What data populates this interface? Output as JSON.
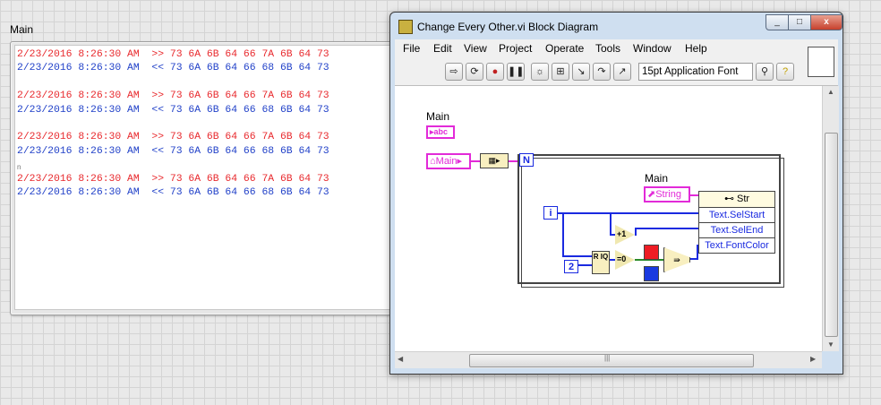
{
  "front_panel": {
    "label": "Main",
    "lines": [
      {
        "ts": "2/23/2016 8:26:30 AM",
        "dir": ">>",
        "bytes": "73 6A 6B 64 66 7A 6B 64 73",
        "color": "red"
      },
      {
        "ts": "2/23/2016 8:26:30 AM",
        "dir": "<<",
        "bytes": "73 6A 6B 64 66 68 6B 64 73",
        "color": "blue"
      },
      {
        "ts": "2/23/2016 8:26:30 AM",
        "dir": ">>",
        "bytes": "73 6A 6B 64 66 7A 6B 64 73",
        "color": "red"
      },
      {
        "ts": "2/23/2016 8:26:30 AM",
        "dir": "<<",
        "bytes": "73 6A 6B 64 66 68 6B 64 73",
        "color": "blue"
      },
      {
        "ts": "2/23/2016 8:26:30 AM",
        "dir": ">>",
        "bytes": "73 6A 6B 64 66 7A 6B 64 73",
        "color": "red"
      },
      {
        "ts": "2/23/2016 8:26:30 AM",
        "dir": "<<",
        "bytes": "73 6A 6B 64 66 68 6B 64 73",
        "color": "blue"
      },
      {
        "ts": "2/23/2016 8:26:30 AM",
        "dir": ">>",
        "bytes": "73 6A 6B 64 66 7A 6B 64 73",
        "color": "red"
      },
      {
        "ts": "2/23/2016 8:26:30 AM",
        "dir": "<<",
        "bytes": "73 6A 6B 64 66 68 6B 64 73",
        "color": "blue"
      }
    ]
  },
  "window": {
    "title": "Change Every Other.vi Block Diagram",
    "menu": [
      "File",
      "Edit",
      "View",
      "Project",
      "Operate",
      "Tools",
      "Window",
      "Help"
    ],
    "font_selector": "15pt Application Font",
    "toolbar_icons": [
      "run-arrow-icon",
      "run-continuous-icon",
      "abort-icon",
      "pause-icon",
      "highlight-bulb-icon",
      "retain-wire-icon",
      "step-into-icon",
      "step-over-icon",
      "step-out-icon",
      "align-icon",
      "search-icon",
      "help-icon"
    ]
  },
  "diagram": {
    "main_label_1": "Main",
    "main_terminal_1": "abc",
    "main_ref": "Main",
    "loop_count": "N",
    "main_label_2": "Main",
    "string_ref": "String",
    "prop_header": "Str",
    "props": [
      "Text.SelStart",
      "Text.SelEnd",
      "Text.FontColor"
    ],
    "iteration": "i",
    "constant_2": "2",
    "op_add1": "+1",
    "op_eq0": "=0",
    "quotient_label": "R IQ",
    "colors": {
      "red": "#ee1c24",
      "blue": "#1a3ae0",
      "wire": "#1a2ae0",
      "ref_wire": "#e22ad8"
    }
  },
  "scrollbars": {
    "h_grip": "|||",
    "v_grip": "="
  }
}
